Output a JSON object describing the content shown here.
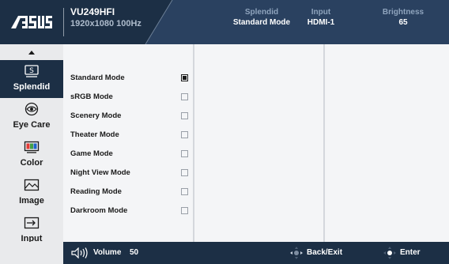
{
  "header": {
    "brand": "ASUS",
    "model": "VU249HFI",
    "resolution": "1920x1080 100Hz",
    "info": [
      {
        "label": "Splendid",
        "value": "Standard Mode"
      },
      {
        "label": "Input",
        "value": "HDMI-1"
      },
      {
        "label": "Brightness",
        "value": "65"
      }
    ]
  },
  "sidebar": {
    "items": [
      {
        "label": "Splendid",
        "icon": "splendid-icon",
        "active": true
      },
      {
        "label": "Eye Care",
        "icon": "eye-care-icon",
        "active": false
      },
      {
        "label": "Color",
        "icon": "color-icon",
        "active": false
      },
      {
        "label": "Image",
        "icon": "image-icon",
        "active": false
      },
      {
        "label": "Input",
        "icon": "input-icon",
        "active": false
      }
    ]
  },
  "modes": {
    "items": [
      {
        "label": "Standard Mode",
        "selected": true
      },
      {
        "label": "sRGB Mode",
        "selected": false
      },
      {
        "label": "Scenery Mode",
        "selected": false
      },
      {
        "label": "Theater Mode",
        "selected": false
      },
      {
        "label": "Game Mode",
        "selected": false
      },
      {
        "label": "Night View Mode",
        "selected": false
      },
      {
        "label": "Reading Mode",
        "selected": false
      },
      {
        "label": "Darkroom Mode",
        "selected": false
      }
    ]
  },
  "footer": {
    "volume_label": "Volume",
    "volume_value": "50",
    "back_label": "Back/Exit",
    "enter_label": "Enter"
  },
  "colors": {
    "header_bg": "#1c2f45",
    "accent_text": "#8fa4bd",
    "panel_bg": "#f4f5f7"
  }
}
